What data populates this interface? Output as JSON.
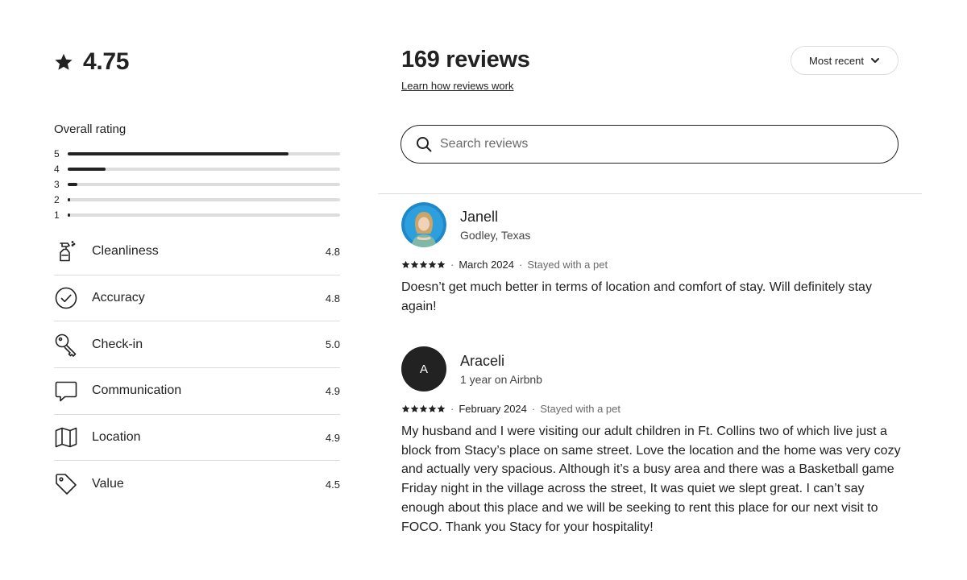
{
  "rating": {
    "value": "4.75",
    "icon": "star-icon"
  },
  "overall": {
    "title": "Overall rating",
    "distribution": [
      {
        "stars": "5",
        "fraction": 0.81
      },
      {
        "stars": "4",
        "fraction": 0.14
      },
      {
        "stars": "3",
        "fraction": 0.035
      },
      {
        "stars": "2",
        "fraction": 0.008
      },
      {
        "stars": "1",
        "fraction": 0.008
      }
    ]
  },
  "categories": [
    {
      "label": "Cleanliness",
      "value": "4.8",
      "icon": "spray-bottle-icon"
    },
    {
      "label": "Accuracy",
      "value": "4.8",
      "icon": "check-circle-icon"
    },
    {
      "label": "Check-in",
      "value": "5.0",
      "icon": "key-icon"
    },
    {
      "label": "Communication",
      "value": "4.9",
      "icon": "chat-bubble-icon"
    },
    {
      "label": "Location",
      "value": "4.9",
      "icon": "map-icon"
    },
    {
      "label": "Value",
      "value": "4.5",
      "icon": "tag-icon"
    }
  ],
  "header": {
    "title": "169 reviews",
    "learn_link": "Learn how reviews work",
    "sort_label": "Most recent"
  },
  "search": {
    "placeholder": "Search reviews"
  },
  "reviews": [
    {
      "name": "Janell",
      "subtitle": "Godley, Texas",
      "avatar_initial": "",
      "rating": 5,
      "date": "March 2024",
      "trip": "Stayed with a pet",
      "text": "Doesn’t get much better in terms of location and comfort of stay. Will definitely stay again!"
    },
    {
      "name": "Araceli",
      "subtitle": "1 year on Airbnb",
      "avatar_initial": "A",
      "rating": 5,
      "date": "February 2024",
      "trip": "Stayed with a pet",
      "text": "My husband and I were visiting our adult children in Ft. Collins two of which live just a block from Stacy’s place on same street. Love the location and the home was very cozy and actually very spacious. Although it’s a busy area and there was a Basketball game Friday night in the village across the street, It was quiet we slept great. I can’t say enough about this place and we will be seeking to rent this place for our next visit to FOCO. Thank you Stacy for your hospitality!"
    }
  ],
  "colors": {
    "text": "#222222",
    "muted": "#6a6a6a",
    "border": "#dddddd",
    "avatar_bg": "#1e88c8"
  }
}
